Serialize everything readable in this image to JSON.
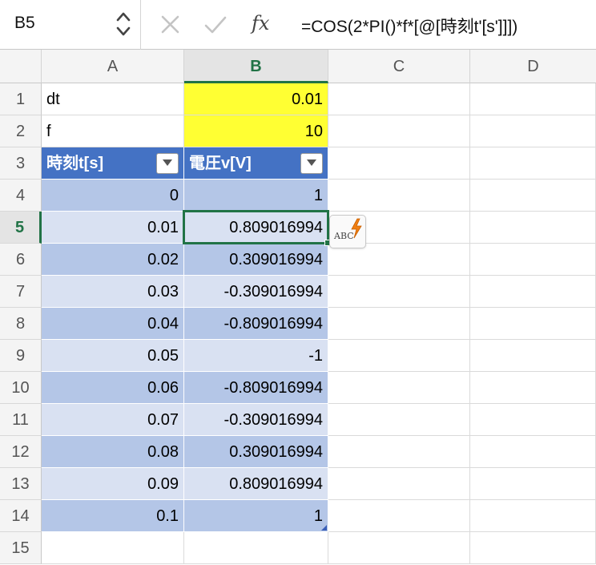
{
  "formula_bar": {
    "name_box": "B5",
    "fx_label": "fx",
    "formula": "=COS(2*PI()*f*[@[時刻t'[s']]])"
  },
  "columns": [
    "A",
    "B",
    "C",
    "D"
  ],
  "rows": [
    "1",
    "2",
    "3",
    "4",
    "5",
    "6",
    "7",
    "8",
    "9",
    "10",
    "11",
    "12",
    "13",
    "14",
    "15"
  ],
  "active_cell": "B5",
  "params": [
    {
      "label": "dt",
      "value": "0.01"
    },
    {
      "label": "f",
      "value": "10"
    }
  ],
  "table": {
    "headers": [
      "時刻t[s]",
      "電圧v[V]"
    ],
    "rows": [
      [
        "0",
        "1"
      ],
      [
        "0.01",
        "0.809016994"
      ],
      [
        "0.02",
        "0.309016994"
      ],
      [
        "0.03",
        "-0.309016994"
      ],
      [
        "0.04",
        "-0.809016994"
      ],
      [
        "0.05",
        "-1"
      ],
      [
        "0.06",
        "-0.809016994"
      ],
      [
        "0.07",
        "-0.309016994"
      ],
      [
        "0.08",
        "0.309016994"
      ],
      [
        "0.09",
        "0.809016994"
      ],
      [
        "0.1",
        "1"
      ]
    ]
  },
  "smart_tag": {
    "text": "ABC",
    "icon": "lightning-icon"
  },
  "colors": {
    "accent": "#217346",
    "header_fill": "#4472c4",
    "band_dark": "#b4c6e7",
    "band_light": "#d9e1f2",
    "highlight": "#ffff33"
  }
}
